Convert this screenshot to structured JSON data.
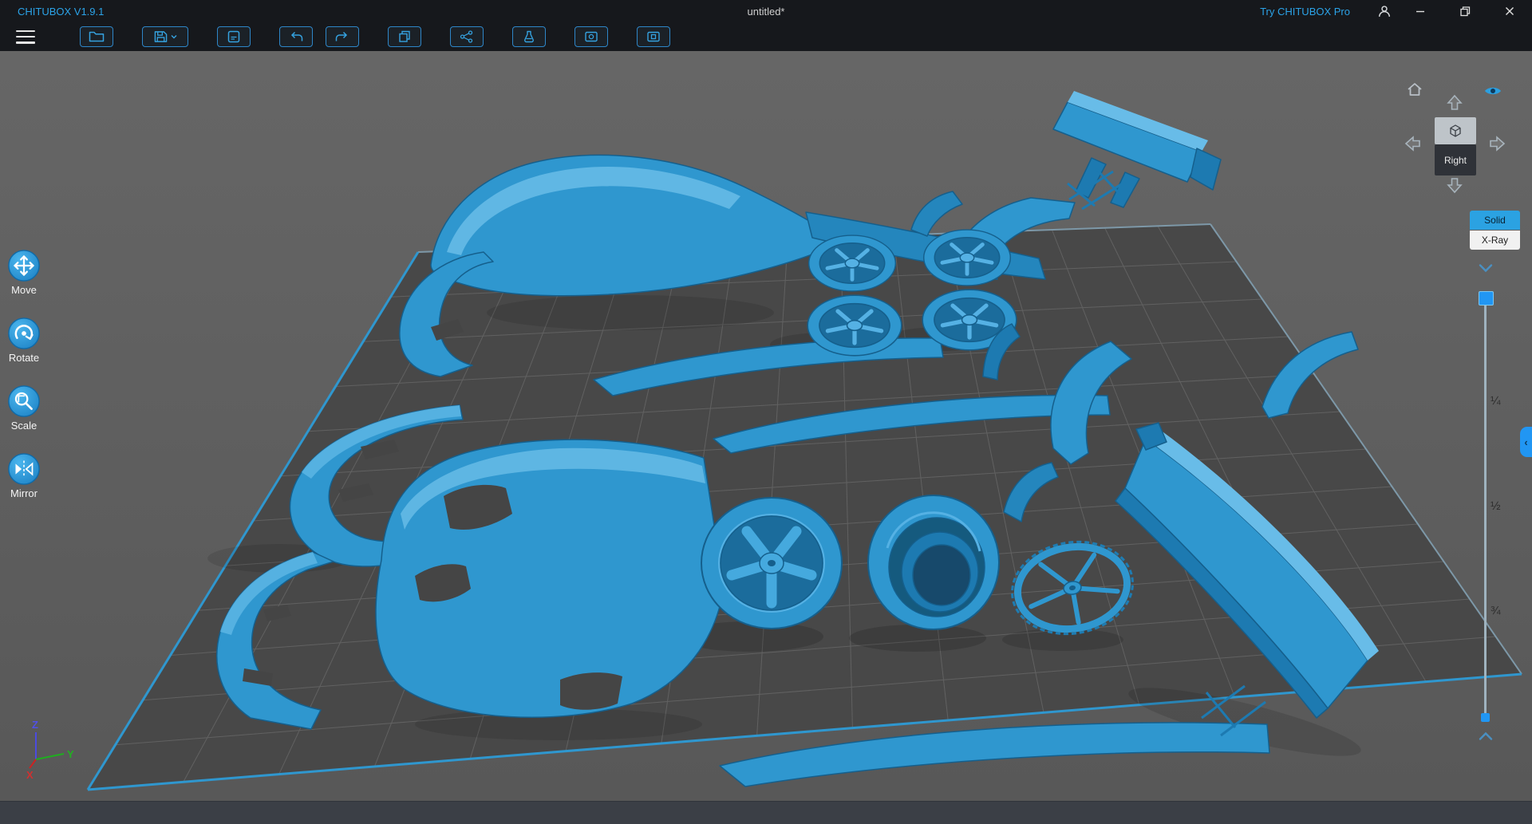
{
  "window": {
    "app_title": "CHITUBOX V1.9.1",
    "document_title": "untitled*",
    "pro_link": "Try CHITUBOX Pro",
    "control_icons": [
      "user-icon",
      "minimize-icon",
      "maximize-icon",
      "close-icon"
    ]
  },
  "toolbar": {
    "menu_icon": "hamburger-icon",
    "buttons": [
      {
        "name": "open",
        "icon": "folder-icon"
      },
      {
        "name": "save",
        "icon": "save-icon",
        "has_dropdown": true
      },
      {
        "name": "project",
        "icon": "file-box-icon"
      },
      {
        "name": "undo",
        "icon": "undo-arrow-icon"
      },
      {
        "name": "redo",
        "icon": "redo-arrow-icon"
      },
      {
        "name": "copy",
        "icon": "copy-icon"
      },
      {
        "name": "auto-layout",
        "icon": "network-icon"
      },
      {
        "name": "resin",
        "icon": "flask-icon"
      },
      {
        "name": "hollow",
        "icon": "hollow-box-icon"
      },
      {
        "name": "dig-hole",
        "icon": "punch-hole-icon"
      }
    ]
  },
  "tools": {
    "items": [
      {
        "label": "Move",
        "icon": "move-icon"
      },
      {
        "label": "Rotate",
        "icon": "rotate-icon"
      },
      {
        "label": "Scale",
        "icon": "scale-icon"
      },
      {
        "label": "Mirror",
        "icon": "mirror-icon"
      }
    ]
  },
  "view_navigator": {
    "orientation_label": "Right",
    "icons": [
      "home-icon",
      "eye-icon",
      "arrow-up-icon",
      "arrow-left-icon",
      "arrow-right-icon",
      "arrow-down-icon",
      "cube-icon"
    ]
  },
  "render_modes": {
    "options": [
      {
        "label": "Solid",
        "active": true
      },
      {
        "label": "X-Ray",
        "active": false
      }
    ]
  },
  "height_slider": {
    "labels": [
      "¼",
      "½",
      "¾"
    ],
    "handle_position": "top"
  },
  "axes": {
    "x_label": "X",
    "y_label": "Y",
    "z_label": "Z"
  },
  "scene": {
    "model_color": "#2f97cf",
    "plate_color": "#484848",
    "background_color": "#5e5e5e",
    "parts": [
      "roof-panel",
      "windshield-frame",
      "fender-top-right",
      "clip-small",
      "front-bumper-upper",
      "front-bumper-mid",
      "front-bumper-lower",
      "hood",
      "side-skirt-1",
      "side-skirt-2",
      "front-splitter",
      "wheel-small-1",
      "wheel-small-2",
      "wheel-small-3",
      "wheel-small-4",
      "wheel-large-left",
      "wheel-barrel-right",
      "wheel-spoked",
      "rear-wing-small",
      "rear-wing-large",
      "fender-mid",
      "fender-right",
      "fender-lower-small",
      "bracket-small"
    ]
  },
  "colors": {
    "accent": "#2aa1e0",
    "titlebar_bg": "#16181c",
    "viewport_bg": "#5e5e5e",
    "bottom_bar_bg": "#3b3f46",
    "model_blue": "#2f97cf",
    "solid_button_bg": "#2ba2e2",
    "xray_button_bg": "#f1f1f1"
  }
}
